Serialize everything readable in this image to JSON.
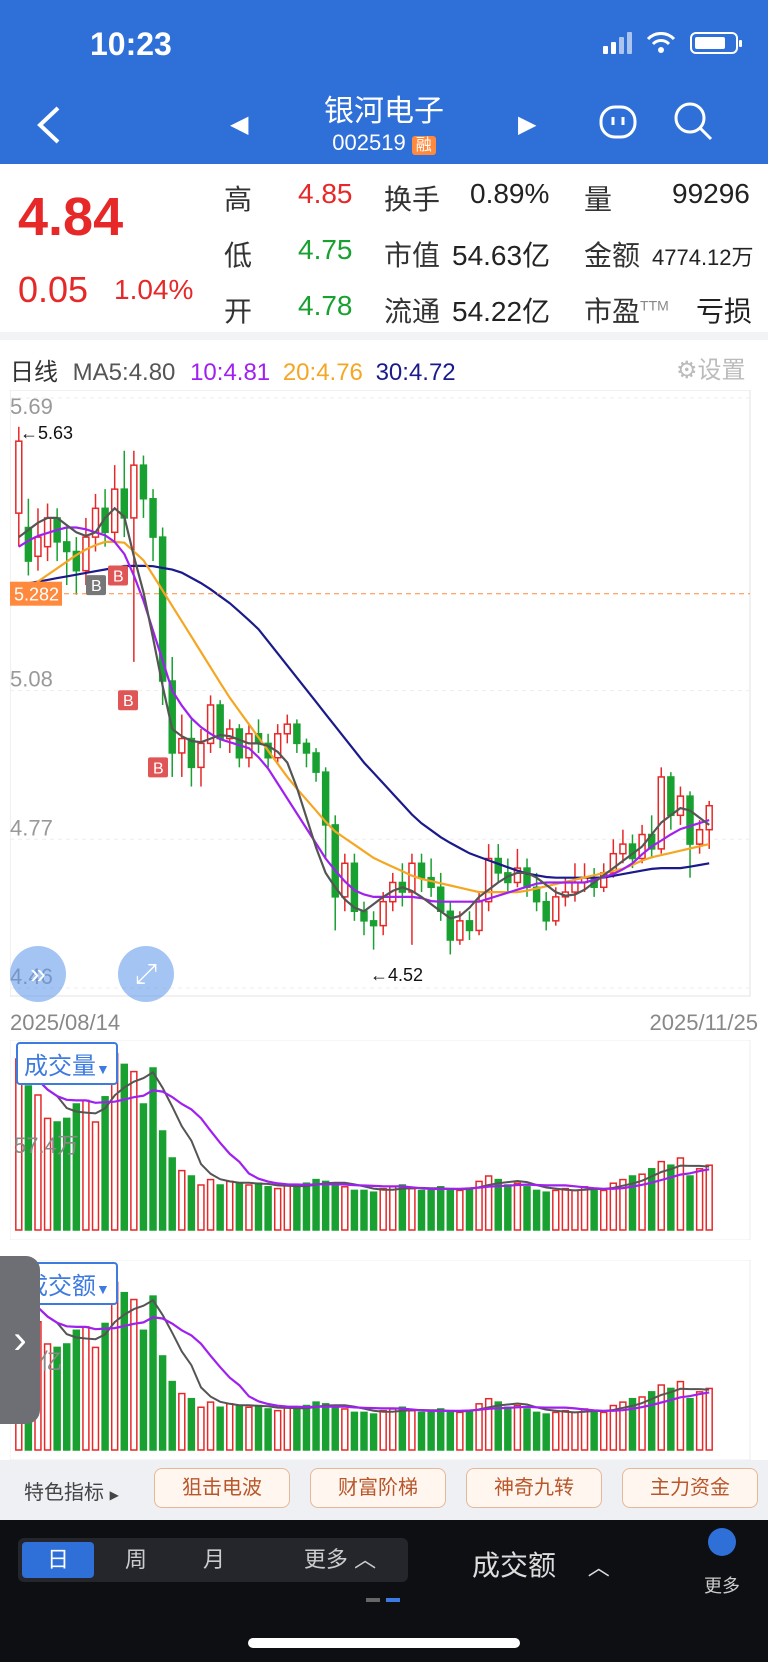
{
  "status": {
    "time": "10:23"
  },
  "header": {
    "name": "银河电子",
    "code": "002519",
    "badge": "融"
  },
  "quote": {
    "price": "4.84",
    "change": "0.05",
    "change_pct": "1.04%",
    "high_label": "高",
    "high": "4.85",
    "low_label": "低",
    "low": "4.75",
    "open_label": "开",
    "open": "4.78",
    "turnover_label": "换手",
    "turnover": "0.89%",
    "mktcap_label": "市值",
    "mktcap": "54.63亿",
    "float_label": "流通",
    "float": "54.22亿",
    "volume_label": "量",
    "volume": "99296",
    "amount_label": "金额",
    "amount": "4774.12万",
    "pe_label": "市盈",
    "pe_sup": "TTM",
    "pe": "亏损"
  },
  "kline": {
    "period_label": "日线",
    "ma5": "MA5:4.80",
    "ma10": "10:4.81",
    "ma20": "20:4.76",
    "ma30": "30:4.72",
    "settings": "设置",
    "y_labels": [
      "5.69",
      "5.08",
      "4.77",
      "4.46"
    ],
    "high_mark": "←5.63",
    "low_mark": "←4.52",
    "price_line": "5.282",
    "start_date": "2025/08/14",
    "end_date": "2025/11/25",
    "signals": [
      "B",
      "B",
      "B",
      "B"
    ]
  },
  "volume_panel": {
    "selector": "成交量",
    "label": "57.4万"
  },
  "amount_panel": {
    "selector": "成交额",
    "label": "亿"
  },
  "indicators": {
    "first": "特色指标",
    "items": [
      "狙击电波",
      "财富阶梯",
      "神奇九转",
      "主力资金"
    ]
  },
  "bottom": {
    "periods": [
      "日",
      "周",
      "月",
      "更多"
    ],
    "active_period": "日",
    "indicator": "成交额",
    "more": "更多"
  },
  "colors": {
    "header": "#2f6fd8",
    "up": "#e62828",
    "down": "#18a030",
    "ma5": "#555555",
    "ma10": "#a020f0",
    "ma20": "#f5a623",
    "ma30": "#1a1a8c"
  },
  "chart_data": {
    "type": "candlestick",
    "title": "日线",
    "x_range": [
      "2025/08/14",
      "2025/11/25"
    ],
    "ylim": [
      4.46,
      5.69
    ],
    "high": 5.63,
    "low": 4.52,
    "candles": [
      [
        5.45,
        5.6,
        5.63,
        5.38
      ],
      [
        5.42,
        5.35,
        5.48,
        5.32
      ],
      [
        5.36,
        5.4,
        5.46,
        5.33
      ],
      [
        5.38,
        5.44,
        5.47,
        5.35
      ],
      [
        5.44,
        5.39,
        5.46,
        5.35
      ],
      [
        5.39,
        5.37,
        5.42,
        5.3
      ],
      [
        5.37,
        5.33,
        5.4,
        5.28
      ],
      [
        5.33,
        5.4,
        5.44,
        5.3
      ],
      [
        5.4,
        5.46,
        5.49,
        5.37
      ],
      [
        5.46,
        5.41,
        5.5,
        5.38
      ],
      [
        5.41,
        5.5,
        5.55,
        5.39
      ],
      [
        5.5,
        5.44,
        5.58,
        5.4
      ],
      [
        5.44,
        5.55,
        5.58,
        5.14
      ],
      [
        5.55,
        5.48,
        5.57,
        5.44
      ],
      [
        5.48,
        5.4,
        5.5,
        5.35
      ],
      [
        5.4,
        5.1,
        5.42,
        5.05
      ],
      [
        5.1,
        4.95,
        5.15,
        4.9
      ],
      [
        4.95,
        4.98,
        5.03,
        4.9
      ],
      [
        4.98,
        4.92,
        5.02,
        4.88
      ],
      [
        4.92,
        4.97,
        5.0,
        4.88
      ],
      [
        4.97,
        5.05,
        5.07,
        4.95
      ],
      [
        5.05,
        4.98,
        5.06,
        4.96
      ],
      [
        4.98,
        5.0,
        5.02,
        4.95
      ],
      [
        5.0,
        4.94,
        5.01,
        4.92
      ],
      [
        4.94,
        4.99,
        5.01,
        4.92
      ],
      [
        4.99,
        4.97,
        5.02,
        4.95
      ],
      [
        4.97,
        4.94,
        4.99,
        4.92
      ],
      [
        4.94,
        4.99,
        5.01,
        4.93
      ],
      [
        4.99,
        5.01,
        5.03,
        4.97
      ],
      [
        5.01,
        4.97,
        5.02,
        4.95
      ],
      [
        4.97,
        4.95,
        4.98,
        4.92
      ],
      [
        4.95,
        4.91,
        4.96,
        4.89
      ],
      [
        4.91,
        4.8,
        4.92,
        4.73
      ],
      [
        4.8,
        4.65,
        4.82,
        4.58
      ],
      [
        4.65,
        4.72,
        4.74,
        4.62
      ],
      [
        4.72,
        4.62,
        4.74,
        4.6
      ],
      [
        4.62,
        4.6,
        4.64,
        4.57
      ],
      [
        4.6,
        4.59,
        4.62,
        4.54
      ],
      [
        4.59,
        4.64,
        4.66,
        4.57
      ],
      [
        4.64,
        4.68,
        4.7,
        4.62
      ],
      [
        4.68,
        4.66,
        4.72,
        4.63
      ],
      [
        4.66,
        4.72,
        4.74,
        4.55
      ],
      [
        4.72,
        4.69,
        4.74,
        4.66
      ],
      [
        4.69,
        4.67,
        4.73,
        4.65
      ],
      [
        4.67,
        4.62,
        4.7,
        4.6
      ],
      [
        4.62,
        4.56,
        4.64,
        4.53
      ],
      [
        4.56,
        4.6,
        4.62,
        4.55
      ],
      [
        4.6,
        4.58,
        4.62,
        4.56
      ],
      [
        4.58,
        4.64,
        4.66,
        4.57
      ],
      [
        4.64,
        4.73,
        4.76,
        4.62
      ],
      [
        4.73,
        4.7,
        4.76,
        4.68
      ],
      [
        4.7,
        4.68,
        4.73,
        4.66
      ],
      [
        4.68,
        4.71,
        4.75,
        4.67
      ],
      [
        4.71,
        4.67,
        4.73,
        4.65
      ],
      [
        4.67,
        4.64,
        4.7,
        4.62
      ],
      [
        4.64,
        4.6,
        4.66,
        4.58
      ],
      [
        4.6,
        4.65,
        4.67,
        4.59
      ],
      [
        4.65,
        4.66,
        4.69,
        4.63
      ],
      [
        4.66,
        4.68,
        4.72,
        4.64
      ],
      [
        4.68,
        4.69,
        4.72,
        4.66
      ],
      [
        4.69,
        4.67,
        4.71,
        4.65
      ],
      [
        4.67,
        4.7,
        4.72,
        4.66
      ],
      [
        4.7,
        4.74,
        4.77,
        4.69
      ],
      [
        4.74,
        4.76,
        4.79,
        4.72
      ],
      [
        4.76,
        4.73,
        4.78,
        4.71
      ],
      [
        4.73,
        4.78,
        4.8,
        4.72
      ],
      [
        4.78,
        4.75,
        4.82,
        4.73
      ],
      [
        4.75,
        4.9,
        4.92,
        4.74
      ],
      [
        4.9,
        4.82,
        4.91,
        4.79
      ],
      [
        4.82,
        4.86,
        4.88,
        4.8
      ],
      [
        4.86,
        4.76,
        4.87,
        4.69
      ],
      [
        4.76,
        4.79,
        4.81,
        4.74
      ],
      [
        4.79,
        4.84,
        4.85,
        4.75
      ]
    ],
    "ma5": [
      5.4,
      5.42,
      5.44,
      5.44,
      5.42,
      5.4,
      5.41,
      5.45,
      5.47,
      5.36,
      5.26,
      5.12,
      5.0,
      4.98,
      4.97,
      4.98,
      4.99,
      4.98,
      4.97,
      4.97,
      4.96,
      4.93,
      4.86,
      4.77,
      4.7,
      4.66,
      4.63,
      4.62,
      4.64,
      4.66,
      4.67,
      4.66,
      4.64,
      4.62,
      4.6,
      4.62,
      4.65,
      4.67,
      4.69,
      4.7,
      4.7,
      4.68,
      4.66,
      4.65,
      4.66,
      4.68,
      4.7,
      4.72,
      4.74,
      4.76,
      4.8,
      4.82,
      4.84,
      4.82,
      4.8
    ],
    "ma10": [
      5.38,
      5.4,
      5.41,
      5.42,
      5.42,
      5.41,
      5.4,
      5.36,
      5.28,
      5.18,
      5.08,
      5.03,
      5.0,
      4.98,
      4.97,
      4.96,
      4.93,
      4.88,
      4.83,
      4.78,
      4.73,
      4.69,
      4.66,
      4.65,
      4.65,
      4.65,
      4.65,
      4.64,
      4.64,
      4.64,
      4.64,
      4.65,
      4.66,
      4.67,
      4.68,
      4.68,
      4.68,
      4.68,
      4.69,
      4.7,
      4.72,
      4.75,
      4.77,
      4.79,
      4.8,
      4.81
    ],
    "ma20": [
      5.28,
      5.31,
      5.34,
      5.37,
      5.39,
      5.39,
      5.35,
      5.28,
      5.21,
      5.14,
      5.07,
      5.01,
      4.95,
      4.89,
      4.84,
      4.79,
      4.76,
      4.73,
      4.71,
      4.69,
      4.68,
      4.67,
      4.66,
      4.66,
      4.66,
      4.67,
      4.68,
      4.69,
      4.7,
      4.71,
      4.73,
      4.74,
      4.75,
      4.76
    ],
    "ma30": [
      5.3,
      5.31,
      5.32,
      5.33,
      5.34,
      5.34,
      5.33,
      5.3,
      5.26,
      5.21,
      5.14,
      5.07,
      5.0,
      4.93,
      4.87,
      4.81,
      4.77,
      4.74,
      4.72,
      4.7,
      4.69,
      4.69,
      4.69,
      4.7,
      4.71,
      4.71,
      4.72
    ]
  }
}
